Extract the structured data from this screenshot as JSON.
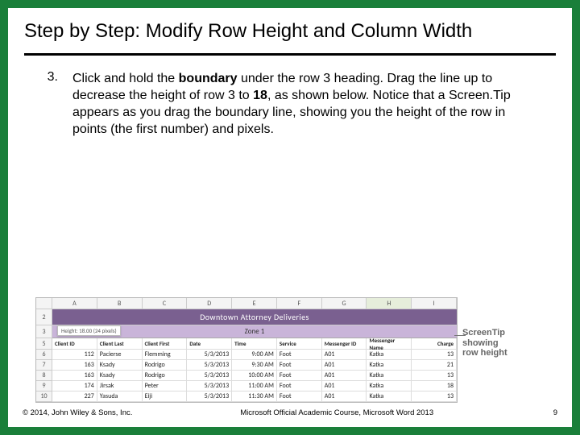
{
  "header": {
    "title": "Step by Step: Modify Row Height and Column Width"
  },
  "step": {
    "number": "3.",
    "p1a": "Click and hold the ",
    "p1b": "boundary",
    "p1c": " under the row 3 heading. Drag the line up to decrease the height of row 3 to ",
    "p1d": "18",
    "p1e": ", as shown below. Notice that a Screen.Tip appears as you drag the boundary line, showing you the height of the row in points (the first number) and pixels."
  },
  "sheet": {
    "cols": [
      "A",
      "B",
      "C",
      "D",
      "E",
      "F",
      "G",
      "H",
      "I"
    ],
    "selcol_index": 7,
    "row_band_num": "2",
    "band_title": "Downtown Attorney Deliveries",
    "zone_row_num": "3",
    "zone_label": "Zone 1",
    "screentip": "Height: 18.00 (24 pixels)",
    "head_row_num": "5",
    "headers": [
      "Client ID",
      "Client Last",
      "Client First",
      "Date",
      "Time",
      "Service",
      "Messenger ID",
      "Messenger Name",
      "Charge"
    ],
    "rows": [
      {
        "num": "6",
        "cells": [
          "112",
          "Pacierse",
          "Flemming",
          "5/3/2013",
          "9:00 AM",
          "Foot",
          "A01",
          "Katka",
          "13"
        ]
      },
      {
        "num": "7",
        "cells": [
          "163",
          "Ksady",
          "Rodrigo",
          "5/3/2013",
          "9:30 AM",
          "Foot",
          "A01",
          "Katka",
          "21"
        ]
      },
      {
        "num": "8",
        "cells": [
          "163",
          "Ksady",
          "Rodrigo",
          "5/3/2013",
          "10:00 AM",
          "Foot",
          "A01",
          "Katka",
          "13"
        ]
      },
      {
        "num": "9",
        "cells": [
          "174",
          "Jirsak",
          "Peter",
          "5/3/2013",
          "11:00 AM",
          "Foot",
          "A01",
          "Katka",
          "18"
        ]
      },
      {
        "num": "10",
        "cells": [
          "227",
          "Yasuda",
          "Eiji",
          "5/3/2013",
          "11:30 AM",
          "Foot",
          "A01",
          "Katka",
          "13"
        ]
      }
    ]
  },
  "callout": {
    "line1": "ScreenTip",
    "line2": "showing",
    "line3": "row height"
  },
  "footer": {
    "left": "© 2014, John Wiley & Sons, Inc.",
    "mid": "Microsoft Official Academic Course, Microsoft Word 2013",
    "page": "9"
  }
}
